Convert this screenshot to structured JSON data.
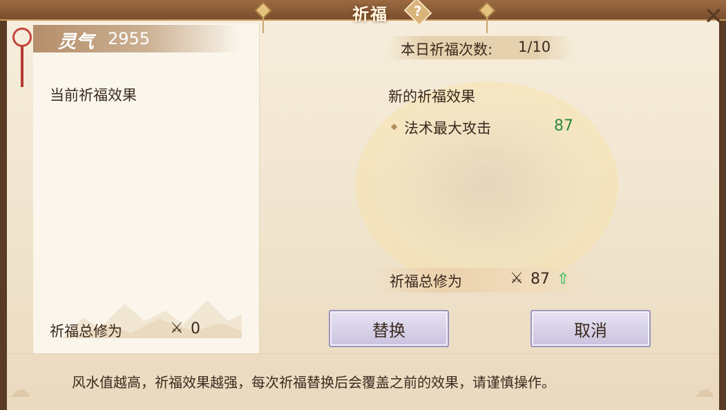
{
  "window": {
    "title": "祈福"
  },
  "header": {
    "help_icon": "question-mark-icon",
    "close_icon": "close-x-icon"
  },
  "left_panel": {
    "lingqi_label": "灵气",
    "lingqi_value": "2955",
    "current_effect_title": "当前祈福效果",
    "total_label": "祈福总修为",
    "total_value": "0"
  },
  "right_panel": {
    "daily_count_label": "本日祈福次数:",
    "daily_count_value": "1/10",
    "new_effect_title": "新的祈福效果",
    "attributes": [
      {
        "name": "法术最大攻击",
        "value": "87"
      }
    ],
    "total_label": "祈福总修为",
    "total_value": "87",
    "total_trend": "up"
  },
  "buttons": {
    "replace_label": "替换",
    "cancel_label": "取消"
  },
  "footer": {
    "note": "风水值越高，祈福效果越强，每次祈福替换后会覆盖之前的效果，请谨慎操作。"
  },
  "colors": {
    "attribute_value": "#2f8a3a",
    "trend_up": "#4cc36a",
    "title_bar": "#7a4f2f"
  }
}
